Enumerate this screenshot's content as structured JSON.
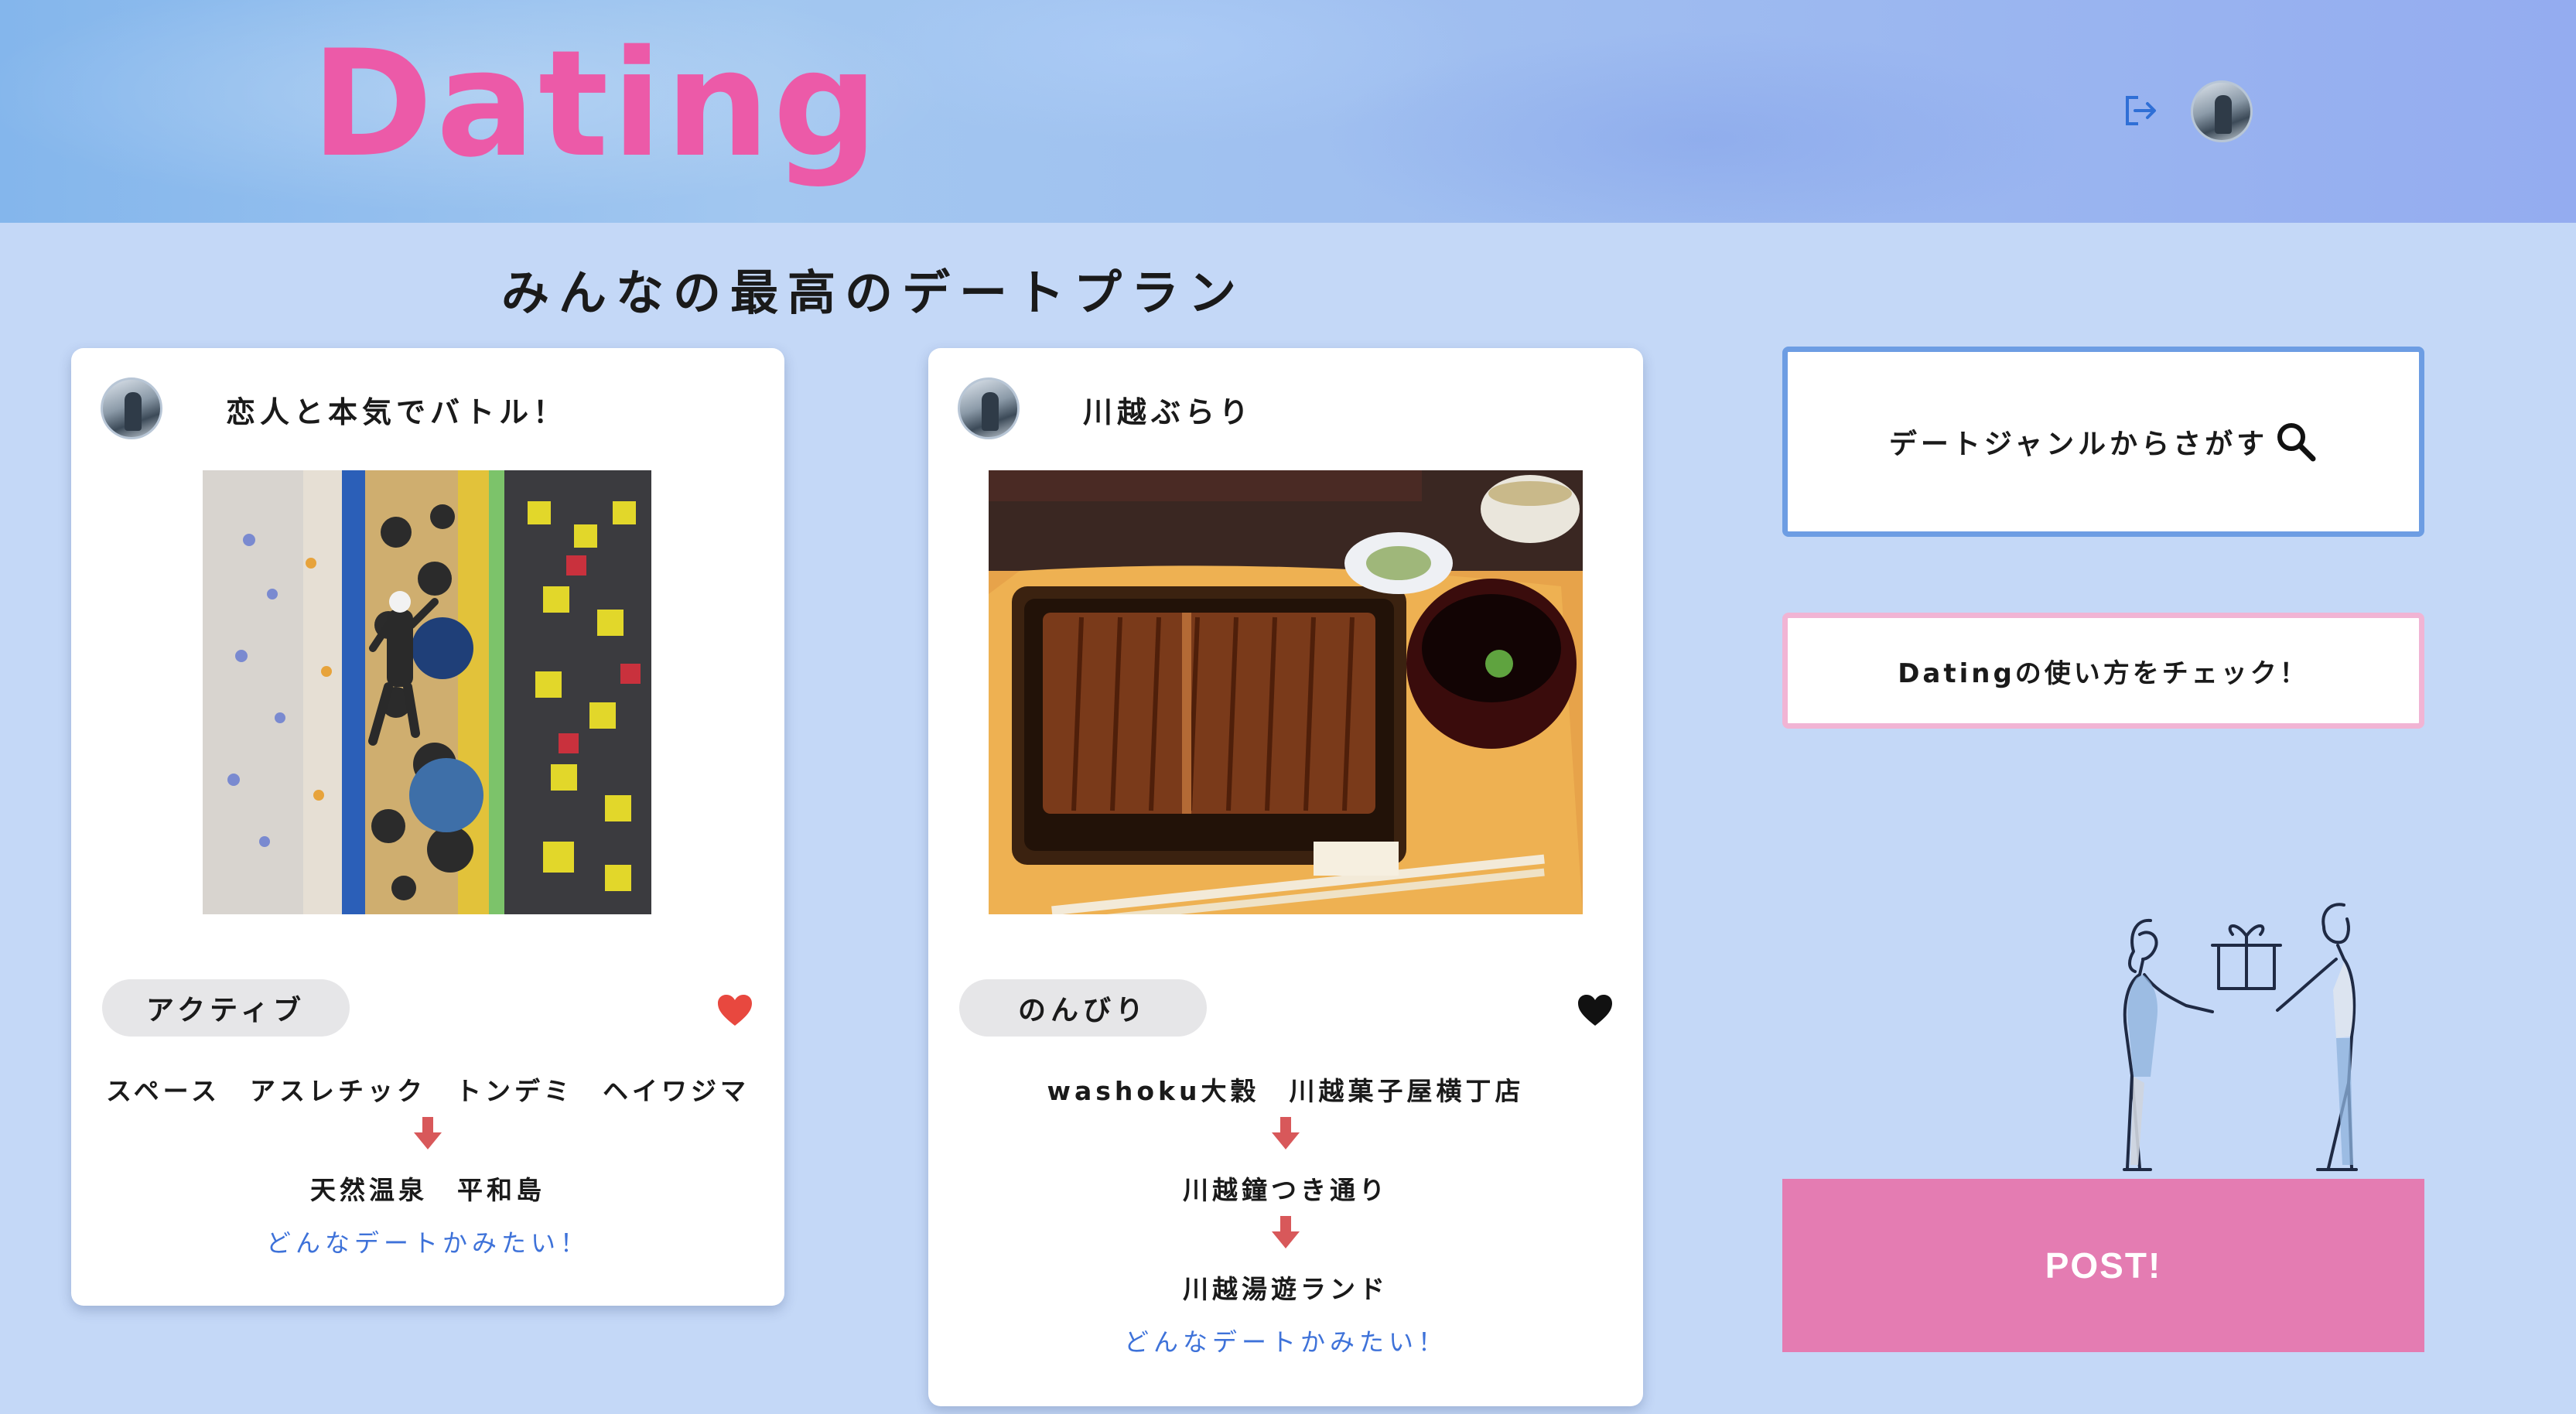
{
  "app": {
    "logo": "Dating"
  },
  "page": {
    "section_title": "みんなの最高のデートプラン"
  },
  "colors": {
    "logo_pink": "#ec5aa8",
    "background": "#c4d8f7",
    "like_red": "#e8483f",
    "link_blue": "#3e72d9",
    "post_button": "#e47cb2",
    "search_border": "#6d9de3",
    "howto_border": "#f1b4d4"
  },
  "header": {
    "logout_icon": "logout-icon",
    "avatar_icon": "user-avatar"
  },
  "cards": [
    {
      "title": "恋人と本気でバトル！",
      "image": "climbing-wall-photo",
      "tag": "アクティブ",
      "liked": true,
      "route": [
        "スペース　アスレチック　トンデミ　ヘイワジマ",
        "天然温泉　平和島"
      ],
      "link": "どんなデートかみたい！"
    },
    {
      "title": "川越ぶらり",
      "image": "unagi-meal-photo",
      "tag": "のんびり",
      "liked": false,
      "route": [
        "washoku大穀　川越菓子屋横丁店",
        "川越鐘つき通り",
        "川越湯遊ランド"
      ],
      "link": "どんなデートかみたい！"
    }
  ],
  "sidebar": {
    "search_label": "デートジャンルからさがす",
    "search_icon": "search-icon",
    "howto_label": "Datingの使い方をチェック！",
    "illustration": "couple-gift-illustration",
    "post_label": "POST!"
  }
}
